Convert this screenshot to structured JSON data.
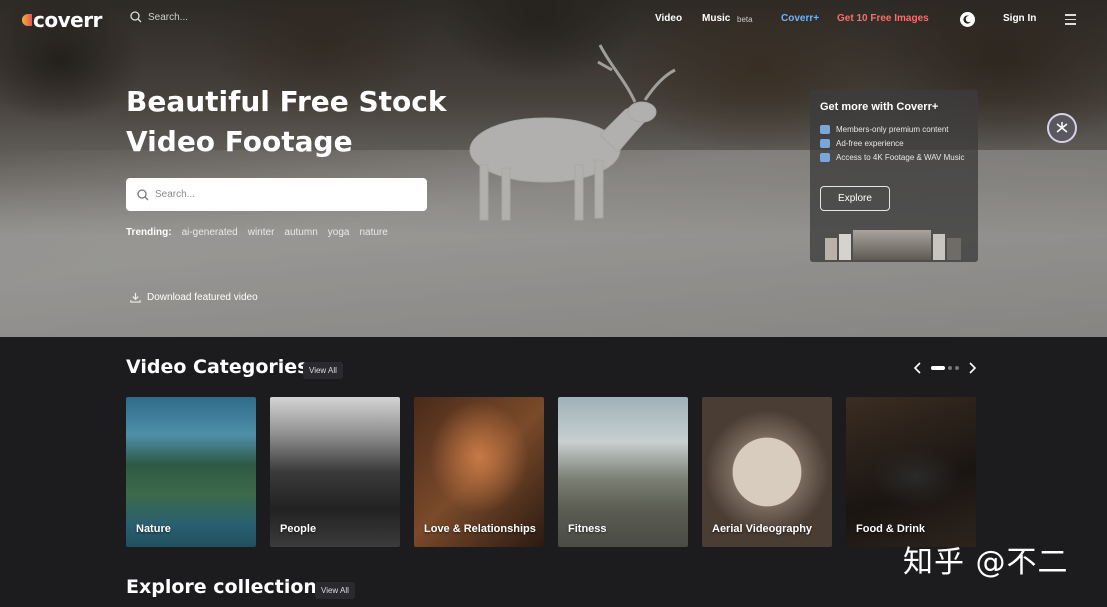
{
  "nav": {
    "logo": "coverr",
    "search_placeholder": "Search...",
    "links": {
      "video": "Video",
      "music": "Music",
      "music_badge": "beta",
      "coverr_plus": "Coverr+",
      "free_images": "Get 10 Free Images",
      "sign_in": "Sign In"
    },
    "colors": {
      "coverr_plus": "#6fb3ff",
      "free_images": "#ff6b6b"
    }
  },
  "hero": {
    "title": "Beautiful Free Stock Video Footage",
    "search_placeholder": "Search...",
    "trending_label": "Trending:",
    "trending_tags": [
      "ai-generated",
      "winter",
      "autumn",
      "yoga",
      "nature"
    ],
    "download_label": "Download featured video"
  },
  "promo": {
    "title": "Get more with Coverr+",
    "features": [
      "Members-only premium content",
      "Ad-free experience",
      "Access to 4K Footage & WAV Music"
    ],
    "button_label": "Explore"
  },
  "categories": {
    "title": "Video Categories",
    "view_all": "View All",
    "items": [
      "Nature",
      "People",
      "Love & Relationships",
      "Fitness",
      "Aerial Videography",
      "Food & Drink"
    ]
  },
  "collections": {
    "title": "Explore collections",
    "view_all": "View All"
  },
  "watermark": "知乎 @不二"
}
